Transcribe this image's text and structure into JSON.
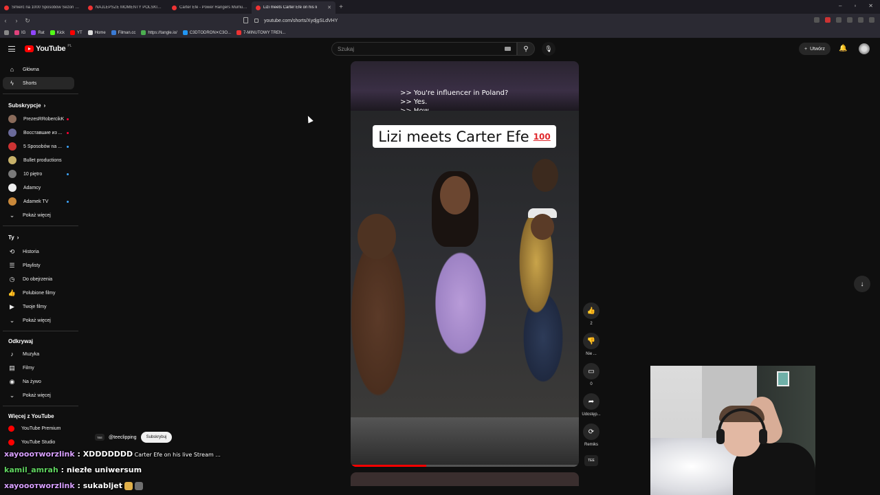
{
  "browser": {
    "tabs": [
      {
        "label": "Śmierć na 1000 Sposobów Sezon 2 C"
      },
      {
        "label": "NAJLEPSZE MOMENTY POLSKIEGO"
      },
      {
        "label": "Carter Efe - Power Rangers Mumu Fi"
      },
      {
        "label": "Lizi meets Carter Efe on his li",
        "active": true
      }
    ],
    "url": "youtube.com/shorts/XydjgSLdVHY",
    "bookmarks": [
      "IG",
      "Rat",
      "Kick",
      "YT",
      "Home",
      "Filman.cc",
      "https://tangle.io/",
      "C3DTODRON✕C3O...",
      "7-MINUTOWY TREN..."
    ]
  },
  "youtube": {
    "logo_text": "YouTube",
    "logo_country": "PL",
    "search_placeholder": "Szukaj",
    "create_label": "Utwórz",
    "sidebar": {
      "main": [
        {
          "label": "Główna",
          "icon": "home-icon"
        },
        {
          "label": "Shorts",
          "icon": "shorts-icon",
          "active": true
        }
      ],
      "subscriptions_title": "Subskrypcje",
      "subscriptions": [
        {
          "label": "PrezesRRobercikK",
          "color": "#8a6b5a",
          "dot": "red"
        },
        {
          "label": "Восставшие из ...",
          "color": "#6a6a9a",
          "dot": "red"
        },
        {
          "label": "5 Sposobów na ...",
          "color": "#c33",
          "dot": "blue"
        },
        {
          "label": "Bullet productions",
          "color": "#c8b26a",
          "dot": ""
        },
        {
          "label": "10 piętro",
          "color": "#7a7a7a",
          "dot": "blue"
        },
        {
          "label": "Adamcy",
          "color": "#eeeeee",
          "dot": ""
        },
        {
          "label": "Adamek TV",
          "color": "#c9883a",
          "dot": "blue"
        }
      ],
      "show_more": "Pokaż więcej",
      "you_title": "Ty",
      "you": [
        {
          "label": "Historia",
          "icon": "history-icon"
        },
        {
          "label": "Playlisty",
          "icon": "playlist-icon"
        },
        {
          "label": "Do obejrzenia",
          "icon": "clock-icon"
        },
        {
          "label": "Polubione filmy",
          "icon": "thumbs-up-icon"
        },
        {
          "label": "Twoje filmy",
          "icon": "video-icon"
        },
        {
          "label": "Pokaż więcej",
          "icon": "chevron-down-icon"
        }
      ],
      "explore_title": "Odkrywaj",
      "explore": [
        {
          "label": "Muzyka",
          "icon": "music-icon"
        },
        {
          "label": "Filmy",
          "icon": "film-icon"
        },
        {
          "label": "Na żywo",
          "icon": "live-icon"
        },
        {
          "label": "Pokaż więcej",
          "icon": "chevron-down-icon"
        }
      ],
      "more_title": "Więcej z YouTube",
      "more": [
        {
          "label": "YouTube Premium"
        },
        {
          "label": "YouTube Studio"
        }
      ]
    },
    "short": {
      "captions": [
        ">> You're influencer in Poland?",
        ">> Yes.",
        ">> How"
      ],
      "title_card": "Lizi meets Carter Efe",
      "title_emoji": "100",
      "progress": 0.33,
      "channel_handle": "@teeclipping",
      "channel_badge": "TEE",
      "subscribe_label": "Subskrybuj"
    },
    "actions": {
      "like_count": "2",
      "dislike_label": "Nie ...",
      "comments_count": "0",
      "share_label": "Udostęp...",
      "remix_label": "Remiks"
    }
  },
  "chat": [
    {
      "user": "xayooотworzlink",
      "message": "XDDDDDDD",
      "extra": "Carter Efe on his live Stream ..."
    },
    {
      "user": "kamil_amrah",
      "message": "niezłe uniwersum"
    },
    {
      "user": "xayooотworzlink",
      "message": "sukabljet"
    }
  ]
}
